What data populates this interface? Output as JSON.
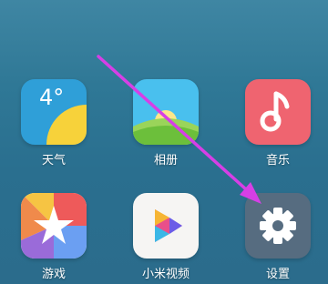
{
  "apps": [
    {
      "id": "weather",
      "label": "天气",
      "temp": "4°"
    },
    {
      "id": "gallery",
      "label": "相册"
    },
    {
      "id": "music",
      "label": "音乐"
    },
    {
      "id": "games",
      "label": "游戏"
    },
    {
      "id": "video",
      "label": "小米视频"
    },
    {
      "id": "settings",
      "label": "设置"
    }
  ],
  "annotation": {
    "color": "#d63fe6",
    "target": "settings"
  },
  "colors": {
    "weather": "#2f9fd8",
    "gallery": "#49c0ee",
    "music": "#ef6470",
    "settings": "#566c80"
  },
  "icons": [
    "weather-icon",
    "gallery-icon",
    "music-icon",
    "games-icon",
    "video-icon",
    "settings-icon"
  ]
}
